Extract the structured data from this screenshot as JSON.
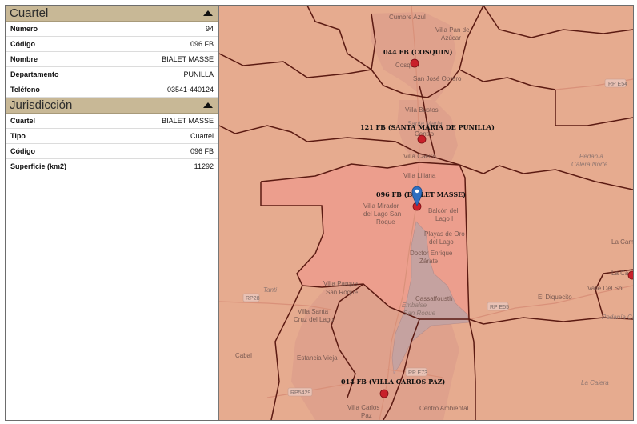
{
  "sections": {
    "cuartel": {
      "title": "Cuartel",
      "rows": [
        {
          "key": "Número",
          "value": "94"
        },
        {
          "key": "Código",
          "value": "096 FB"
        },
        {
          "key": "Nombre",
          "value": "BIALET MASSE"
        },
        {
          "key": "Departamento",
          "value": "PUNILLA"
        },
        {
          "key": "Teléfono",
          "value": "03541-440124"
        }
      ]
    },
    "jurisdiccion": {
      "title": "Jurisdicción",
      "rows": [
        {
          "key": "Cuartel",
          "value": "BIALET MASSE"
        },
        {
          "key": "Tipo",
          "value": "Cuartel"
        },
        {
          "key": "Código",
          "value": "096 FB"
        },
        {
          "key": "Superficie (km2)",
          "value": "11292"
        }
      ]
    }
  },
  "map": {
    "colors": {
      "base": "#e6ab8f",
      "selected": "#ec9e8d",
      "lake": "#c7a4a0",
      "urban": "#dc9d8a",
      "border": "#5b1a12",
      "marker": "#c8202a",
      "pin": "#2f6fc0"
    },
    "quarters": [
      {
        "label": "044 FB (COSQUIN)"
      },
      {
        "label": "121 FB (SANTA MARIA DE PUNILLA)"
      },
      {
        "label": "096 FB (BIALET MASSE)"
      },
      {
        "label": "014 FB (VILLA CARLOS PAZ)"
      }
    ],
    "places": [
      {
        "name": "Cumbre Azul"
      },
      {
        "name": "Villa Pan de"
      },
      {
        "name": "Azúcar"
      },
      {
        "name": "Cosquín"
      },
      {
        "name": "San José Obrero"
      },
      {
        "name": "Villa Bustos"
      },
      {
        "name": "Santa María"
      },
      {
        "name": "Centro"
      },
      {
        "name": "Villa Caeiro"
      },
      {
        "name": "Villa Liliana"
      },
      {
        "name": "Balcón del"
      },
      {
        "name": "Lago I"
      },
      {
        "name": "Villa Mirador"
      },
      {
        "name": "del Lago San"
      },
      {
        "name": "Roque"
      },
      {
        "name": "Playas de Oro"
      },
      {
        "name": "del Lago"
      },
      {
        "name": "Doctor Enrique"
      },
      {
        "name": "Zárate"
      },
      {
        "name": "Villa Parque"
      },
      {
        "name": "San Roque"
      },
      {
        "name": "Cassaffousth"
      },
      {
        "name": "Villa Santa"
      },
      {
        "name": "Cruz del Lago"
      },
      {
        "name": "Estancia Vieja"
      },
      {
        "name": "Villa Carlos"
      },
      {
        "name": "Paz"
      },
      {
        "name": "Centro Ambiental"
      },
      {
        "name": "El Diquecito"
      },
      {
        "name": "Valle Del Sol"
      },
      {
        "name": "La Campi"
      },
      {
        "name": "La Ca"
      },
      {
        "name": "Tanti"
      },
      {
        "name": "Cabal"
      }
    ],
    "water_labels": [
      {
        "name": "Embalse"
      },
      {
        "name": "San Roque"
      }
    ],
    "region_labels": [
      {
        "name": "Pedanía"
      },
      {
        "name": "Calera Norte"
      },
      {
        "name": "Pedanía Calera"
      },
      {
        "name": "La Calera"
      }
    ],
    "roads": [
      {
        "name": "RP E54"
      },
      {
        "name": "RP28"
      },
      {
        "name": "RP E55"
      },
      {
        "name": "RP E73"
      },
      {
        "name": "RP5429"
      }
    ]
  }
}
